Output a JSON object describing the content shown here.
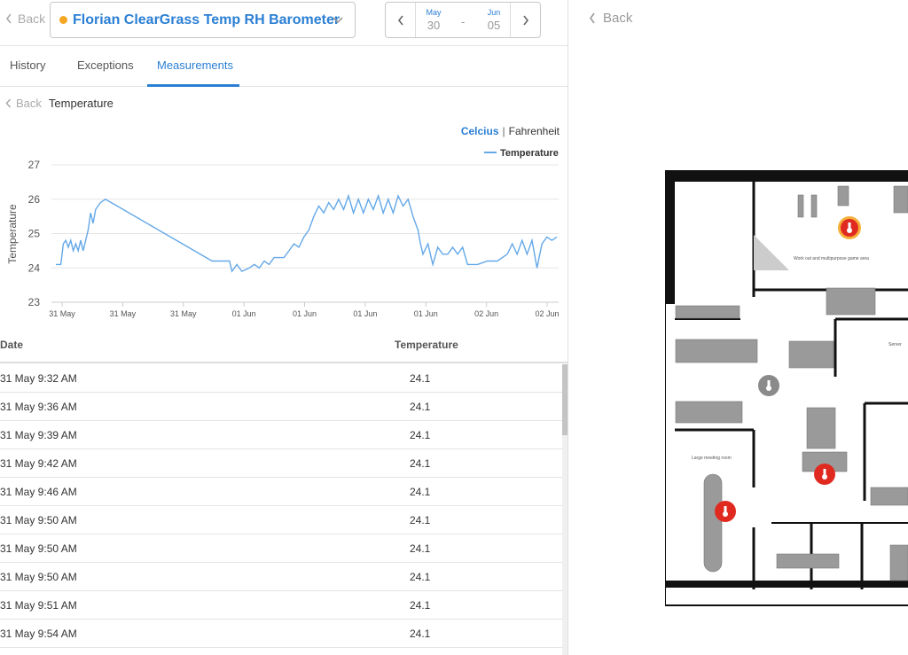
{
  "header": {
    "back_label": "Back",
    "device_name": "Florian ClearGrass Temp RH Barometer",
    "device_status_color": "#f5a623",
    "date_from": {
      "month": "May",
      "day": "30"
    },
    "date_sep": "-",
    "date_to": {
      "month": "Jun",
      "day": "05"
    }
  },
  "tabs": [
    {
      "label": "History"
    },
    {
      "label": "Exceptions"
    },
    {
      "label": "Measurements"
    }
  ],
  "active_tab": "Measurements",
  "breadcrumb": {
    "back_label": "Back",
    "title": "Temperature"
  },
  "units": {
    "celsius": "Celcius",
    "separator": "|",
    "fahrenheit": "Fahrenheit",
    "active": "Celcius"
  },
  "chart_data": {
    "type": "line",
    "ylabel": "Temperature",
    "ylim": [
      23,
      27
    ],
    "yticks": [
      "27",
      "26",
      "25",
      "24",
      "23"
    ],
    "xtick_labels": [
      "31 May",
      "31 May",
      "31 May",
      "01 Jun",
      "01 Jun",
      "01 Jun",
      "01 Jun",
      "02 Jun",
      "02 Jun"
    ],
    "grid": "horizontal",
    "legend": "top-right",
    "series": [
      {
        "name": "Temperature",
        "color": "#64a8e8",
        "points": [
          [
            0,
            24.1
          ],
          [
            2,
            24.1
          ],
          [
            3,
            24.7
          ],
          [
            4,
            24.8
          ],
          [
            5,
            24.6
          ],
          [
            6,
            24.8
          ],
          [
            7,
            24.5
          ],
          [
            8,
            24.7
          ],
          [
            9,
            24.5
          ],
          [
            10,
            24.8
          ],
          [
            11,
            24.5
          ],
          [
            12,
            24.8
          ],
          [
            13,
            25.1
          ],
          [
            14,
            25.6
          ],
          [
            15,
            25.3
          ],
          [
            16,
            25.7
          ],
          [
            17,
            25.8
          ],
          [
            18,
            25.9
          ],
          [
            20,
            26.0
          ],
          [
            63,
            24.2
          ],
          [
            70,
            24.2
          ],
          [
            71,
            23.9
          ],
          [
            73,
            24.1
          ],
          [
            75,
            23.9
          ],
          [
            78,
            24.0
          ],
          [
            80,
            24.1
          ],
          [
            82,
            24.0
          ],
          [
            84,
            24.2
          ],
          [
            86,
            24.1
          ],
          [
            88,
            24.3
          ],
          [
            92,
            24.3
          ],
          [
            94,
            24.5
          ],
          [
            96,
            24.7
          ],
          [
            98,
            24.6
          ],
          [
            100,
            24.9
          ],
          [
            102,
            25.1
          ],
          [
            104,
            25.5
          ],
          [
            106,
            25.8
          ],
          [
            108,
            25.6
          ],
          [
            110,
            25.9
          ],
          [
            112,
            25.7
          ],
          [
            114,
            26.0
          ],
          [
            116,
            25.7
          ],
          [
            118,
            26.1
          ],
          [
            120,
            25.6
          ],
          [
            122,
            26.0
          ],
          [
            124,
            25.6
          ],
          [
            126,
            26.0
          ],
          [
            128,
            25.7
          ],
          [
            130,
            26.1
          ],
          [
            132,
            25.6
          ],
          [
            134,
            26.0
          ],
          [
            136,
            25.6
          ],
          [
            138,
            26.1
          ],
          [
            140,
            25.8
          ],
          [
            142,
            26.0
          ],
          [
            144,
            25.5
          ],
          [
            146,
            25.1
          ],
          [
            147,
            24.7
          ],
          [
            148,
            24.4
          ],
          [
            150,
            24.7
          ],
          [
            152,
            24.1
          ],
          [
            154,
            24.6
          ],
          [
            156,
            24.4
          ],
          [
            158,
            24.4
          ],
          [
            160,
            24.6
          ],
          [
            162,
            24.4
          ],
          [
            164,
            24.6
          ],
          [
            166,
            24.1
          ],
          [
            170,
            24.1
          ],
          [
            174,
            24.2
          ],
          [
            178,
            24.2
          ],
          [
            180,
            24.3
          ],
          [
            182,
            24.4
          ],
          [
            184,
            24.7
          ],
          [
            186,
            24.4
          ],
          [
            188,
            24.8
          ],
          [
            190,
            24.4
          ],
          [
            192,
            24.8
          ],
          [
            194,
            24.0
          ],
          [
            196,
            24.7
          ],
          [
            198,
            24.9
          ],
          [
            200,
            24.8
          ],
          [
            202,
            24.9
          ]
        ]
      }
    ]
  },
  "table": {
    "headers": [
      "Date",
      "Temperature"
    ],
    "rows": [
      [
        "31 May 9:32 AM",
        "24.1"
      ],
      [
        "31 May 9:36 AM",
        "24.1"
      ],
      [
        "31 May 9:39 AM",
        "24.1"
      ],
      [
        "31 May 9:42 AM",
        "24.1"
      ],
      [
        "31 May 9:46 AM",
        "24.1"
      ],
      [
        "31 May 9:50 AM",
        "24.1"
      ],
      [
        "31 May 9:50 AM",
        "24.1"
      ],
      [
        "31 May 9:50 AM",
        "24.1"
      ],
      [
        "31 May 9:51 AM",
        "24.1"
      ],
      [
        "31 May 9:54 AM",
        "24.1"
      ]
    ]
  },
  "floorplan": {
    "back_label": "Back",
    "labels": {
      "game_area": "Work out and multipurpose game area",
      "meeting_room": "Large meeting room",
      "server": "Server"
    },
    "sensors": [
      {
        "icon": "thermometer-icon",
        "status": "alert",
        "color": "#e02a20"
      },
      {
        "icon": "thermometer-icon",
        "status": "inactive",
        "color": "#8a8a8a"
      },
      {
        "icon": "thermometer-icon",
        "status": "alert",
        "color": "#e02a20"
      },
      {
        "icon": "thermometer-icon",
        "status": "alert",
        "color": "#e02a20"
      }
    ]
  }
}
